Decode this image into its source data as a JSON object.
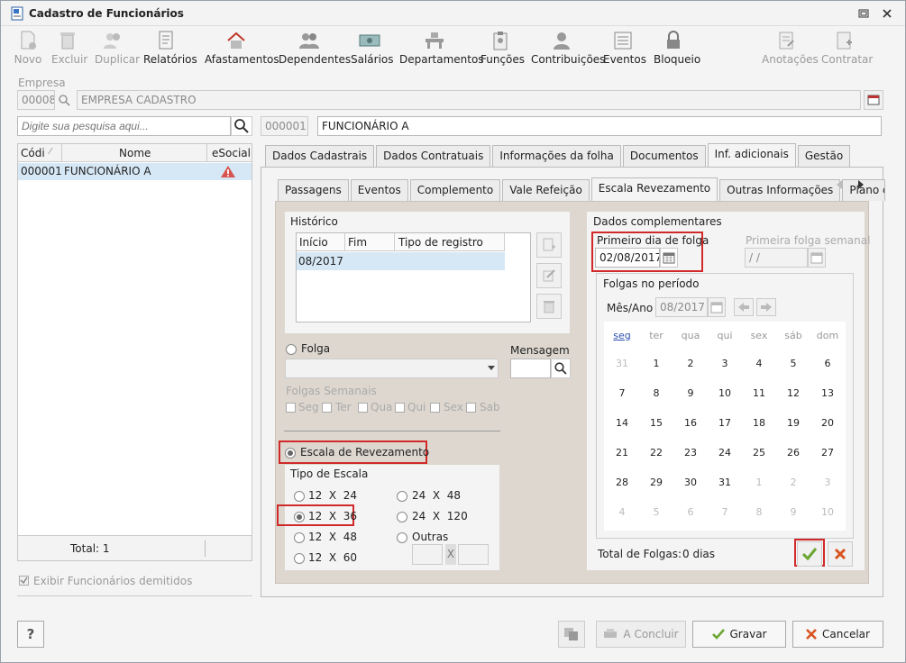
{
  "window": {
    "title": "Cadastro de Funcionários"
  },
  "toolbar": {
    "novo": "Novo",
    "excluir": "Excluir",
    "duplicar": "Duplicar",
    "relatorios": "Relatórios",
    "afastamentos": "Afastamentos",
    "dependentes": "Dependentes",
    "salarios": "Salários",
    "departamentos": "Departamentos",
    "funcoes": "Funções",
    "contribuicoes": "Contribuições",
    "eventos": "Eventos",
    "bloqueio": "Bloqueio",
    "anotacoes": "Anotações",
    "contratar": "Contratar"
  },
  "empresa": {
    "label": "Empresa",
    "code": "00008",
    "name": "EMPRESA CADASTRO"
  },
  "search": {
    "placeholder": "Digite sua pesquisa aqui..."
  },
  "funcionario": {
    "code": "000001",
    "name": "FUNCIONÁRIO A"
  },
  "list": {
    "col_code": "Códi",
    "col_name": "Nome",
    "col_esocial": "eSocial",
    "rows": [
      {
        "code": "000001",
        "name": "FUNCIONÁRIO A"
      }
    ],
    "total": "Total: 1"
  },
  "exibir_demitidos": "Exibir Funcionários demitidos",
  "tabs": [
    "Dados Cadastrais",
    "Dados Contratuais",
    "Informações da folha",
    "Documentos",
    "Inf. adicionais",
    "Gestão"
  ],
  "subtabs": [
    "Passagens",
    "Eventos",
    "Complemento",
    "Vale Refeição",
    "Escala Revezamento",
    "Outras Informações",
    "Plano de"
  ],
  "historico": {
    "title": "Histórico",
    "col_inicio": "Início",
    "col_fim": "Fim",
    "col_tipo": "Tipo de registro",
    "rows": [
      {
        "inicio": "08/2017",
        "fim": "",
        "tipo": ""
      }
    ]
  },
  "folga": {
    "label": "Folga",
    "mensagem": "Mensagem",
    "semanais": "Folgas Semanais",
    "dias": [
      "Seg",
      "Ter",
      "Qua",
      "Qui",
      "Sex",
      "Sab"
    ]
  },
  "escala": {
    "label": "Escala de Revezamento",
    "tipo": "Tipo de Escala",
    "options_left": [
      "12",
      "12",
      "12",
      "12"
    ],
    "x": "X",
    "left_values": [
      "24",
      "36",
      "48",
      "60"
    ],
    "right_values": [
      "24",
      "120"
    ],
    "right_first": [
      "12",
      "24"
    ],
    "outras": "Outras",
    "x_small": "X"
  },
  "dados": {
    "title": "Dados complementares",
    "primeiro_dia": "Primeiro dia de folga",
    "primeiro_valor": "02/08/2017",
    "primeira_semanal": "Primeira folga semanal",
    "semanal_valor": "/ /",
    "folgas_periodo": "Folgas no período",
    "mesano_label": "Mês/Ano",
    "mesano": "08/2017",
    "total_label": "Total de Folgas:",
    "total_value": "0 dias"
  },
  "calendar": {
    "days": [
      "seg",
      "ter",
      "qua",
      "qui",
      "sex",
      "sáb",
      "dom"
    ],
    "weeks": [
      [
        "31",
        "1",
        "2",
        "3",
        "4",
        "5",
        "6"
      ],
      [
        "7",
        "8",
        "9",
        "10",
        "11",
        "12",
        "13"
      ],
      [
        "14",
        "15",
        "16",
        "17",
        "18",
        "19",
        "20"
      ],
      [
        "21",
        "22",
        "23",
        "24",
        "25",
        "26",
        "27"
      ],
      [
        "28",
        "29",
        "30",
        "31",
        "1",
        "2",
        "3"
      ],
      [
        "4",
        "5",
        "6",
        "7",
        "8",
        "9",
        "10"
      ]
    ]
  },
  "footer": {
    "help": "?",
    "concluir": "A Concluir",
    "gravar": "Gravar",
    "cancelar": "Cancelar"
  }
}
